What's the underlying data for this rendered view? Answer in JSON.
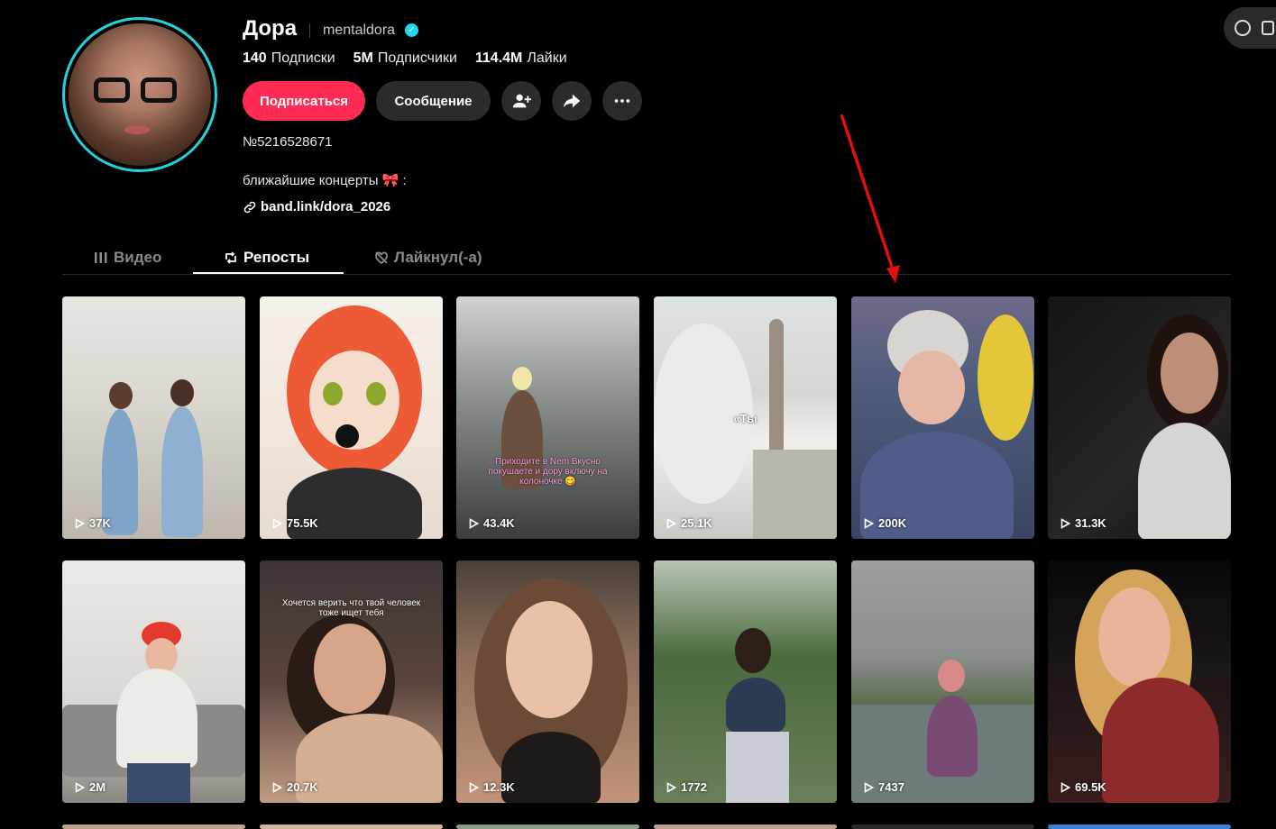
{
  "profile": {
    "name": "Дора",
    "username": "mentaldora",
    "stats": [
      {
        "value": "140",
        "label": "Подписки"
      },
      {
        "value": "5M",
        "label": "Подписчики"
      },
      {
        "value": "114.4M",
        "label": "Лайки"
      }
    ],
    "follow_label": "Подписаться",
    "message_label": "Сообщение",
    "uid": "№5216528671",
    "bio": "ближайшие концерты 🎀 :",
    "link": "band.link/dora_2026"
  },
  "tabs": [
    {
      "label": "Видео",
      "active": false
    },
    {
      "label": "Репосты",
      "active": true
    },
    {
      "label": "Лайкнул(-а)",
      "active": false
    }
  ],
  "videos": [
    {
      "views": "37K"
    },
    {
      "views": "75.5K"
    },
    {
      "views": "43.4K",
      "caption": "Приходите в Nem Вкусно покушаете и дору включу на колоночке 😋"
    },
    {
      "views": "25.1K",
      "caption": "«Ты"
    },
    {
      "views": "200K"
    },
    {
      "views": "31.3K"
    },
    {
      "views": "2M"
    },
    {
      "views": "20.7K",
      "caption": "Хочется верить что твой человек тоже ищет тебя"
    },
    {
      "views": "12.3K"
    },
    {
      "views": "1772"
    },
    {
      "views": "7437"
    },
    {
      "views": "69.5K"
    }
  ],
  "colors": {
    "accent": "#fe2c55",
    "avatar_ring": "#25d0d8",
    "verified": "#20d5ec",
    "annotation_arrow": "#e01010"
  }
}
